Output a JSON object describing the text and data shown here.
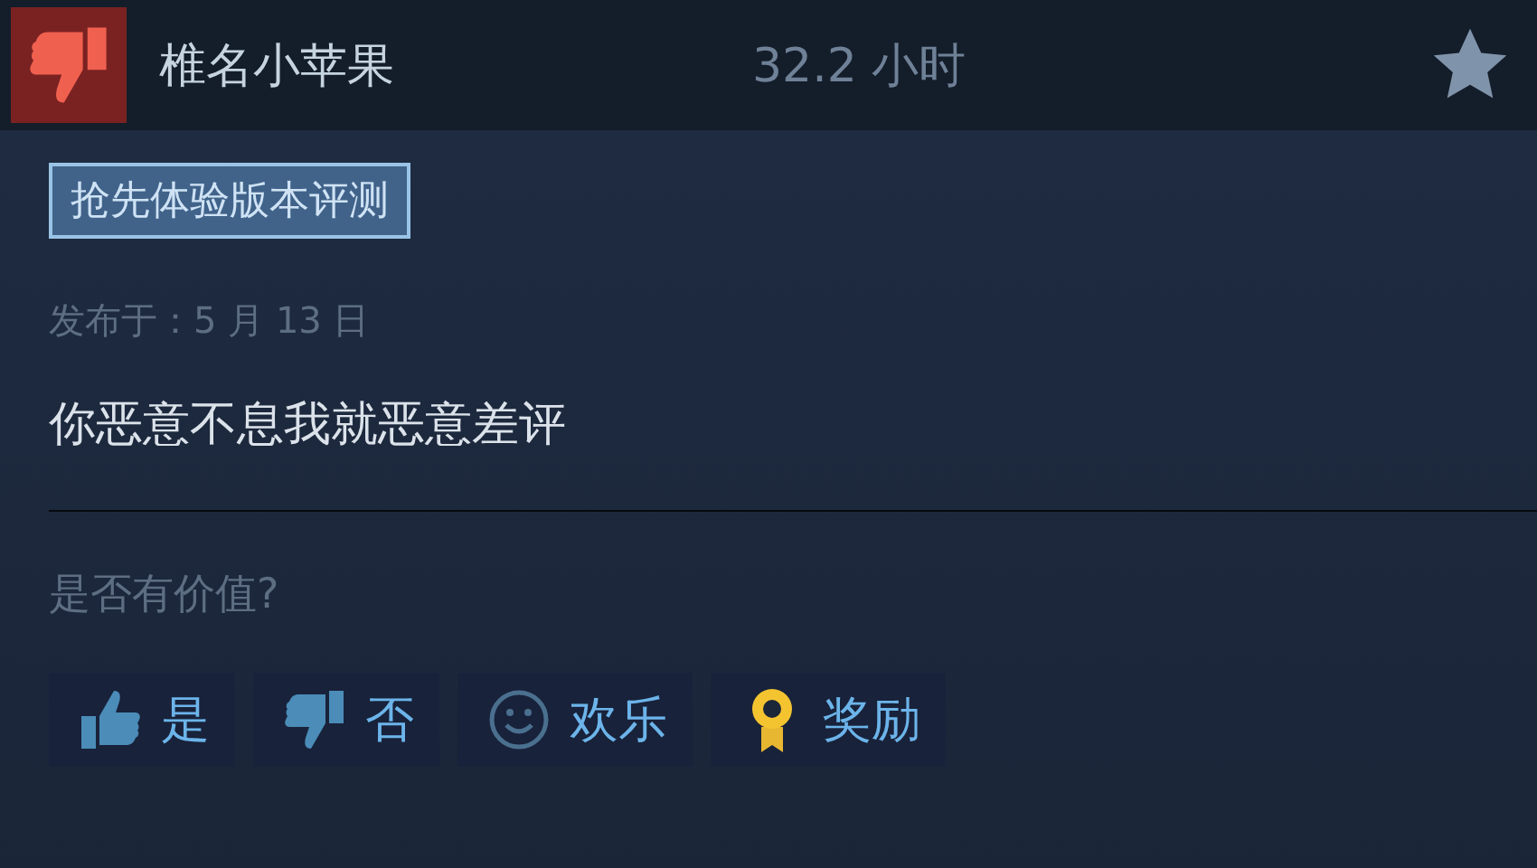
{
  "review": {
    "recommended": false,
    "author": "椎名小苹果",
    "hours": "32.2 小时",
    "tag": "抢先体验版本评测",
    "posted": "发布于：5 月 13 日",
    "text": "你恶意不息我就恶意差评"
  },
  "helpful_prompt": "是否有价值?",
  "buttons": [
    {
      "kind": "yes",
      "label": "是"
    },
    {
      "kind": "no",
      "label": "否"
    },
    {
      "kind": "funny",
      "label": "欢乐"
    },
    {
      "kind": "award",
      "label": "奖励"
    }
  ]
}
